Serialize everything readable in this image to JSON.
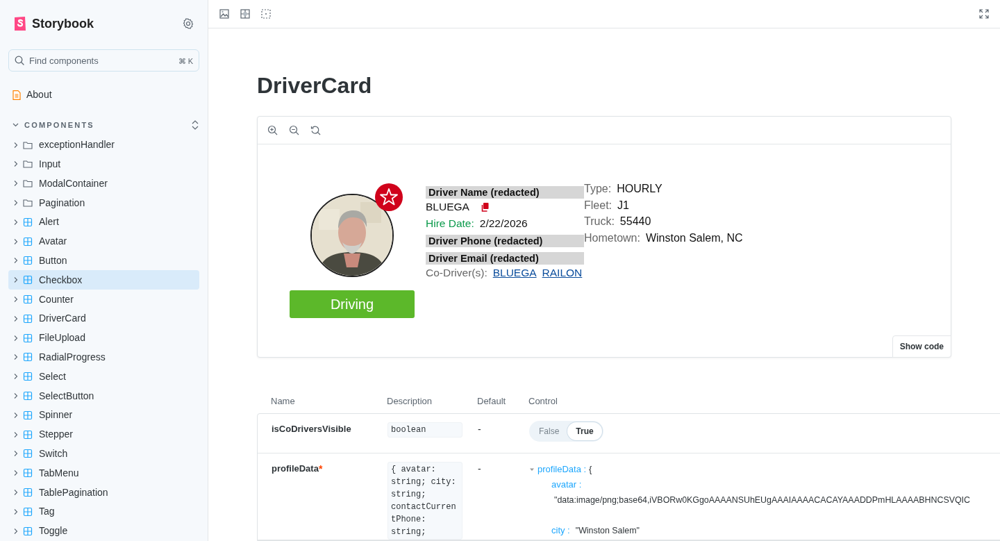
{
  "sidebar": {
    "brand": "Storybook",
    "search": {
      "placeholder": "Find components",
      "shortcut": "⌘ K"
    },
    "pinned": [
      {
        "label": "About"
      }
    ],
    "section": {
      "title": "COMPONENTS",
      "expanded": true
    },
    "items": [
      {
        "label": "exceptionHandler",
        "kind": "folder",
        "selected": false
      },
      {
        "label": "Input",
        "kind": "folder",
        "selected": false
      },
      {
        "label": "ModalContainer",
        "kind": "folder",
        "selected": false
      },
      {
        "label": "Pagination",
        "kind": "folder",
        "selected": false
      },
      {
        "label": "Alert",
        "kind": "component",
        "selected": false
      },
      {
        "label": "Avatar",
        "kind": "component",
        "selected": false
      },
      {
        "label": "Button",
        "kind": "component",
        "selected": false
      },
      {
        "label": "Checkbox",
        "kind": "component",
        "selected": true
      },
      {
        "label": "Counter",
        "kind": "component",
        "selected": false
      },
      {
        "label": "DriverCard",
        "kind": "component",
        "selected": false
      },
      {
        "label": "FileUpload",
        "kind": "component",
        "selected": false
      },
      {
        "label": "RadialProgress",
        "kind": "component",
        "selected": false
      },
      {
        "label": "Select",
        "kind": "component",
        "selected": false
      },
      {
        "label": "SelectButton",
        "kind": "component",
        "selected": false
      },
      {
        "label": "Spinner",
        "kind": "component",
        "selected": false
      },
      {
        "label": "Stepper",
        "kind": "component",
        "selected": false
      },
      {
        "label": "Switch",
        "kind": "component",
        "selected": false
      },
      {
        "label": "TabMenu",
        "kind": "component",
        "selected": false
      },
      {
        "label": "TablePagination",
        "kind": "component",
        "selected": false
      },
      {
        "label": "Tag",
        "kind": "component",
        "selected": false
      },
      {
        "label": "Toggle",
        "kind": "component",
        "selected": false
      }
    ]
  },
  "story": {
    "title": "DriverCard",
    "driver": {
      "status": "Driving",
      "name_label": "Driver Name (redacted)",
      "name": "BLUEGA",
      "hire_date_label": "Hire Date:",
      "hire_date": "2/22/2026",
      "phone": "Driver Phone (redacted)",
      "email": "Driver Email (redacted)",
      "co_drivers_label": "Co-Driver(s):",
      "co_drivers": [
        "BLUEGA",
        "RAILON"
      ],
      "details": [
        {
          "label": "Type:",
          "value": "HOURLY"
        },
        {
          "label": "Fleet:",
          "value": "J1"
        },
        {
          "label": "Truck:",
          "value": "55440"
        },
        {
          "label": "Hometown:",
          "value": "Winston Salem, NC"
        }
      ]
    },
    "show_code": "Show code"
  },
  "args_table": {
    "columns": [
      "Name",
      "Description",
      "Default",
      "Control"
    ],
    "rows": [
      {
        "name": "isCoDriversVisible",
        "type": "boolean",
        "default": "-",
        "control": {
          "kind": "toggle",
          "options": [
            {
              "label": "False",
              "selected": false
            },
            {
              "label": "True",
              "selected": true
            }
          ]
        }
      },
      {
        "name": "profileData",
        "marker": "*",
        "type": "{ avatar: string; city: string; contactCurrentPhone: string;",
        "default": "-",
        "control": {
          "kind": "object",
          "key": "profileData :",
          "open": "{",
          "expanded": true,
          "fields": [
            {
              "key": "avatar :",
              "value": "\"data:image/png;base64,iVBORw0KGgoAAAANSUhEUgAAAIAAAACACAYAAADDPmHLAAAABHNCSVQIC"
            },
            {
              "key": "city :",
              "value": "\"Winston Salem\""
            }
          ]
        }
      }
    ]
  }
}
